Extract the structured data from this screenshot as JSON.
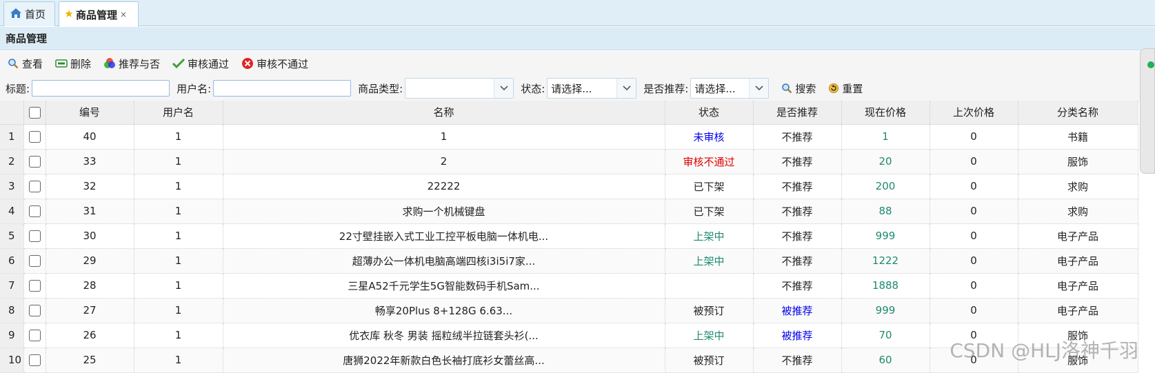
{
  "tabs": [
    {
      "label": "首页",
      "icon": "home-icon"
    },
    {
      "label": "商品管理",
      "icon": "star-icon",
      "closable": "×"
    }
  ],
  "panel": {
    "title": "商品管理"
  },
  "toolbar": {
    "view": "查看",
    "delete": "删除",
    "recommend": "推荐与否",
    "approve": "审核通过",
    "reject": "审核不通过"
  },
  "search": {
    "title_label": "标题:",
    "user_label": "用户名:",
    "type_label": "商品类型:",
    "type_value": "",
    "status_label": "状态:",
    "status_value": "请选择...",
    "recommend_label": "是否推荐:",
    "recommend_value": "请选择...",
    "search_btn": "搜索",
    "reset_btn": "重置"
  },
  "grid": {
    "columns": [
      "编号",
      "用户名",
      "名称",
      "状态",
      "是否推荐",
      "现在价格",
      "上次价格",
      "分类名称"
    ],
    "rows": [
      {
        "rn": "1",
        "id": "40",
        "user": "1",
        "name": "1",
        "status": "未审核",
        "recommend": "不推荐",
        "price": "1",
        "last": "0",
        "category": "书籍"
      },
      {
        "rn": "2",
        "id": "33",
        "user": "1",
        "name": "2",
        "status": "审核不通过",
        "recommend": "不推荐",
        "price": "20",
        "last": "0",
        "category": "服饰"
      },
      {
        "rn": "3",
        "id": "32",
        "user": "1",
        "name": "22222",
        "status": "已下架",
        "recommend": "不推荐",
        "price": "200",
        "last": "0",
        "category": "求购"
      },
      {
        "rn": "4",
        "id": "31",
        "user": "1",
        "name": "求购一个机械键盘",
        "status": "已下架",
        "recommend": "不推荐",
        "price": "88",
        "last": "0",
        "category": "求购"
      },
      {
        "rn": "5",
        "id": "30",
        "user": "1",
        "name": "22寸壁挂嵌入式工业工控平板电脑一体机电...",
        "status": "上架中",
        "recommend": "不推荐",
        "price": "999",
        "last": "0",
        "category": "电子产品"
      },
      {
        "rn": "6",
        "id": "29",
        "user": "1",
        "name": "超薄办公一体机电脑高端四核i3i5i7家...",
        "status": "上架中",
        "recommend": "不推荐",
        "price": "1222",
        "last": "0",
        "category": "电子产品"
      },
      {
        "rn": "7",
        "id": "28",
        "user": "1",
        "name": "三星A52千元学生5G智能数码手机Sam...",
        "status": "",
        "recommend": "不推荐",
        "price": "1888",
        "last": "0",
        "category": "电子产品"
      },
      {
        "rn": "8",
        "id": "27",
        "user": "1",
        "name": "畅享20Plus 8+128G 6.63...",
        "status": "被预订",
        "recommend": "被推荐",
        "price": "999",
        "last": "0",
        "category": "电子产品"
      },
      {
        "rn": "9",
        "id": "26",
        "user": "1",
        "name": "优衣库 秋冬 男装 摇粒绒半拉链套头衫(...",
        "status": "上架中",
        "recommend": "被推荐",
        "price": "70",
        "last": "0",
        "category": "服饰"
      },
      {
        "rn": "10",
        "id": "25",
        "user": "1",
        "name": "唐狮2022年新款白色长袖打底衫女蕾丝高...",
        "status": "被预订",
        "recommend": "不推荐",
        "price": "60",
        "last": "0",
        "category": "服饰"
      }
    ]
  },
  "colors": {
    "status_pending": "#0000ee",
    "status_rejected": "#e00000",
    "status_onsale": "#1f8a6e",
    "status_default": "#222222",
    "recommended": "#0000ee",
    "price": "#1f8a6e"
  },
  "watermark": "CSDN @HLJ洛神千羽"
}
